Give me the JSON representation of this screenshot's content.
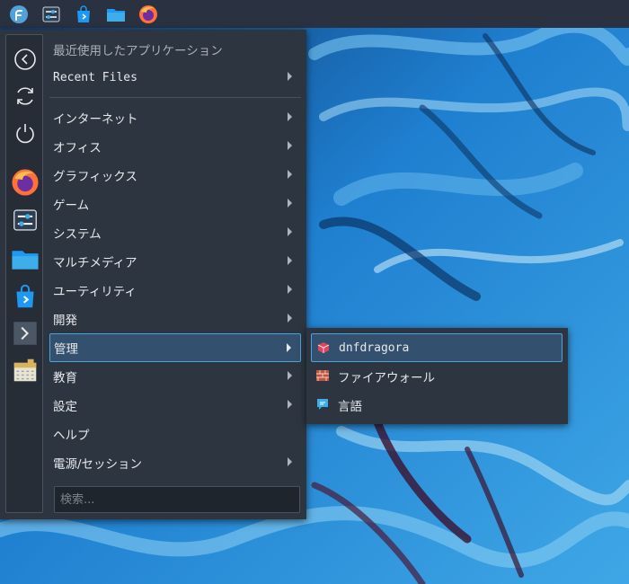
{
  "menu": {
    "recent_apps_header": "最近使用したアプリケーション",
    "recent_files": "Recent Files",
    "categories": [
      {
        "label": "インターネット"
      },
      {
        "label": "オフィス"
      },
      {
        "label": "グラフィックス"
      },
      {
        "label": "ゲーム"
      },
      {
        "label": "システム"
      },
      {
        "label": "マルチメディア"
      },
      {
        "label": "ユーティリティ"
      },
      {
        "label": "開発"
      },
      {
        "label": "管理"
      },
      {
        "label": "教育"
      },
      {
        "label": "設定"
      },
      {
        "label": "ヘルプ"
      },
      {
        "label": "電源/セッション"
      }
    ],
    "search_placeholder": "検索..."
  },
  "submenu": {
    "items": [
      {
        "label": "dnfdragora",
        "icon": "dnfdragora-icon"
      },
      {
        "label": "ファイアウォール",
        "icon": "firewall-icon"
      },
      {
        "label": "言語",
        "icon": "language-icon"
      }
    ]
  },
  "colors": {
    "accent": "#4aa3e0",
    "selection": "#34506f",
    "panel": "#2d3540"
  }
}
